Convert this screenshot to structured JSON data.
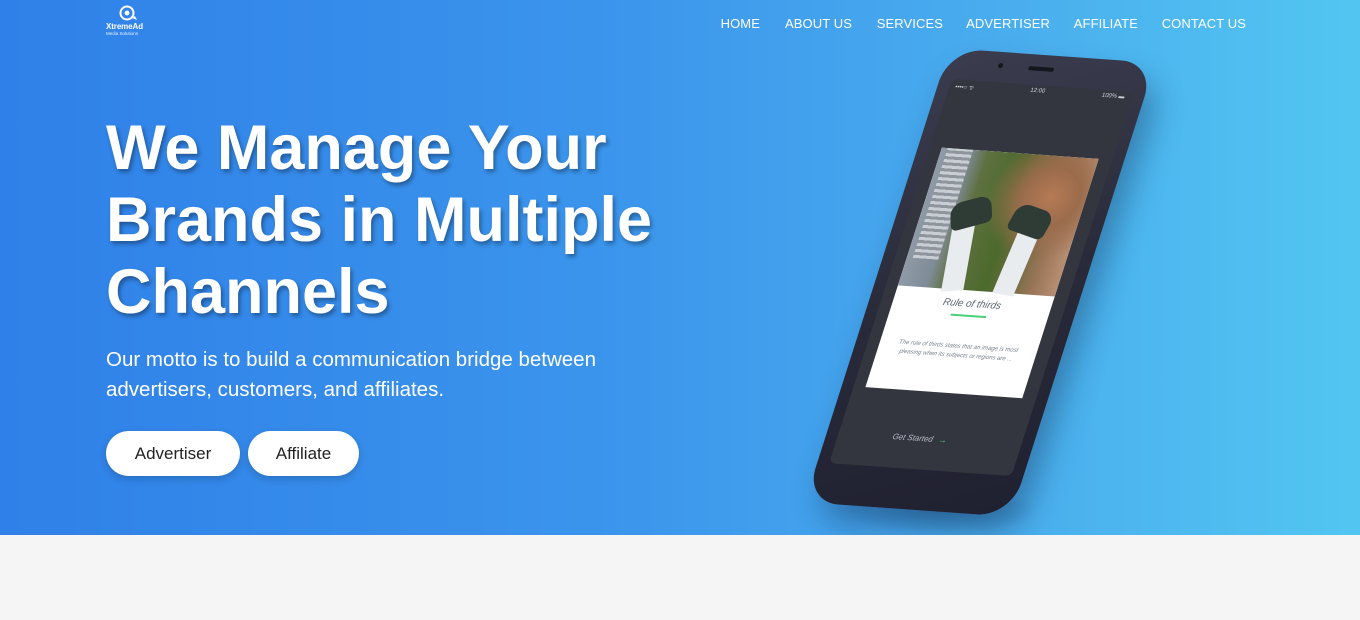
{
  "brand": {
    "name": "XtremeAd",
    "subtitle": "Media Solutions"
  },
  "nav": {
    "items": [
      {
        "label": "HOME"
      },
      {
        "label": "ABOUT US"
      },
      {
        "label": "SERVICES"
      },
      {
        "label": "ADVERTISER"
      },
      {
        "label": "AFFILIATE"
      },
      {
        "label": "CONTACT US"
      }
    ]
  },
  "hero": {
    "headline": [
      "We Manage Your",
      "Brands in Multiple",
      "Channels"
    ],
    "tagline": "Our motto is to build a communication bridge between advertisers, customers, and affiliates.",
    "buttons": {
      "advertiser": "Advertiser",
      "affiliate": "Affiliate"
    }
  },
  "phone": {
    "status": {
      "signal": "••••○ ᯤ",
      "time": "12:00",
      "battery": "100% ▬"
    },
    "card": {
      "title": "Rule of thirds",
      "body": "The rule of thirds states that an image is most pleasing when its subjects or regions are ..."
    },
    "cta": "Get Started",
    "cta_arrow": "→"
  },
  "colors": {
    "hero_gradient_start": "#2f80e8",
    "hero_gradient_end": "#52c6f1",
    "accent_green": "#4cd07a",
    "page_bg": "#f5f5f5"
  }
}
